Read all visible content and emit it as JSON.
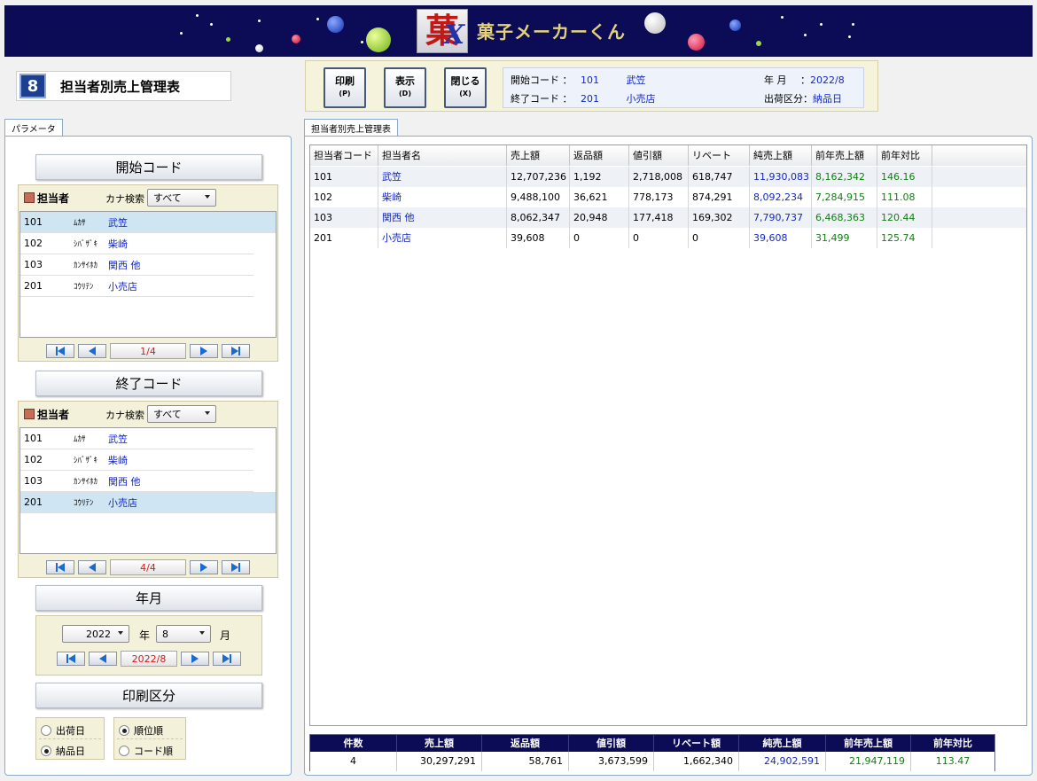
{
  "app": {
    "title": "菓子メーカーくん",
    "logo_char": "菓",
    "logo_mark": "X"
  },
  "screen": {
    "number": "8",
    "title": "担当者別売上管理表"
  },
  "toolbar": {
    "print": {
      "label": "印刷",
      "key": "(P)"
    },
    "display": {
      "label": "表示",
      "key": "(D)"
    },
    "close": {
      "label": "閉じる",
      "key": "(X)"
    }
  },
  "info": {
    "start_code_label": "開始コード ：",
    "start_code": "101",
    "start_name": "武笠",
    "end_code_label": "終了コード ：",
    "end_code": "201",
    "end_name": "小売店",
    "ym_label": "年 月",
    "ym_sep": "：",
    "ym_value": "2022/8",
    "ship_label": "出荷区分：",
    "ship_value": "納品日"
  },
  "tabs": {
    "param": "パラメータ",
    "report": "担当者別売上管理表"
  },
  "params": {
    "start_header": "開始コード",
    "end_header": "終了コード",
    "ym_header": "年月",
    "print_header": "印刷区分",
    "person_label": "担当者",
    "kana_label": "カナ検索",
    "kana_value": "すべて",
    "people": [
      {
        "code": "101",
        "kana": "ﾑｶｻ",
        "name": "武笠"
      },
      {
        "code": "102",
        "kana": "ｼﾊﾞｻﾞｷ",
        "name": "柴崎"
      },
      {
        "code": "103",
        "kana": "ｶﾝｻｲﾎｶ",
        "name": "関西 他"
      },
      {
        "code": "201",
        "kana": "ｺｳﾘﾃﾝ",
        "name": "小売店"
      }
    ],
    "start_page": "1/4",
    "end_page": "4/4",
    "year": "2022",
    "year_unit": "年",
    "month": "8",
    "month_unit": "月",
    "ym_display": "2022/8",
    "radio_ship": [
      "出荷日",
      "納品日"
    ],
    "radio_order": [
      "順位順",
      "コード順"
    ]
  },
  "grid": {
    "headers": [
      "担当者コード",
      "担当者名",
      "売上額",
      "返品額",
      "値引額",
      "リベート",
      "純売上額",
      "前年売上額",
      "前年対比"
    ],
    "rows": [
      [
        "101",
        "武笠",
        "12,707,236",
        "1,192",
        "2,718,008",
        "618,747",
        "11,930,083",
        "8,162,342",
        "146.16"
      ],
      [
        "102",
        "柴崎",
        "9,488,100",
        "36,621",
        "778,173",
        "874,291",
        "8,092,234",
        "7,284,915",
        "111.08"
      ],
      [
        "103",
        "関西 他",
        "8,062,347",
        "20,948",
        "177,418",
        "169,302",
        "7,790,737",
        "6,468,363",
        "120.44"
      ],
      [
        "201",
        "小売店",
        "39,608",
        "0",
        "0",
        "0",
        "39,608",
        "31,499",
        "125.74"
      ]
    ]
  },
  "totals": {
    "headers": [
      "件数",
      "売上額",
      "返品額",
      "値引額",
      "リベート額",
      "純売上額",
      "前年売上額",
      "前年対比"
    ],
    "values": [
      "4",
      "30,297,291",
      "58,761",
      "3,673,599",
      "1,662,340",
      "24,902,591",
      "21,947,119",
      "113.47"
    ]
  },
  "colors": {
    "banner": "#0b0b56",
    "link_blue": "#1428c8",
    "green": "#118011",
    "red": "#d81818",
    "selection": "#cfe5f2"
  }
}
